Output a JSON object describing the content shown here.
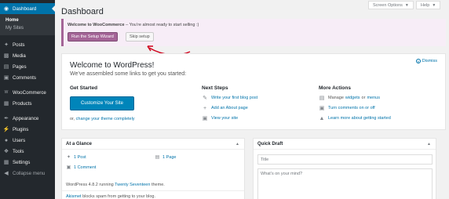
{
  "sidebar": {
    "dashboard": "Dashboard",
    "sub": {
      "home": "Home",
      "my_sites": "My Sites"
    },
    "items": [
      {
        "label": "Posts",
        "icon": "pin-icon"
      },
      {
        "label": "Media",
        "icon": "media-icon"
      },
      {
        "label": "Pages",
        "icon": "pages-icon"
      },
      {
        "label": "Comments",
        "icon": "comments-icon"
      }
    ],
    "items2": [
      {
        "label": "WooCommerce",
        "icon": "woocommerce-icon"
      },
      {
        "label": "Products",
        "icon": "products-icon"
      }
    ],
    "items3": [
      {
        "label": "Appearance",
        "icon": "appearance-icon"
      },
      {
        "label": "Plugins",
        "icon": "plugins-icon"
      },
      {
        "label": "Users",
        "icon": "users-icon"
      },
      {
        "label": "Tools",
        "icon": "tools-icon"
      },
      {
        "label": "Settings",
        "icon": "settings-icon"
      },
      {
        "label": "Collapse menu",
        "icon": "collapse-icon"
      }
    ]
  },
  "header": {
    "title": "Dashboard",
    "screen_options": "Screen Options",
    "help": "Help"
  },
  "wc_notice": {
    "bold": "Welcome to WooCommerce",
    "text": " – You’re almost ready to start selling :)",
    "setup_label": "Run the Setup Wizard",
    "skip_label": "Skip setup",
    "accent": "#a46497"
  },
  "welcome": {
    "title": "Welcome to WordPress!",
    "subtitle": "We’ve assembled some links to get you started:",
    "dismiss": "Dismiss",
    "get_started": {
      "heading": "Get Started",
      "button": "Customize Your Site",
      "or_prefix": "or, ",
      "or_link": "change your theme completely"
    },
    "next_steps": {
      "heading": "Next Steps",
      "items": [
        {
          "label": "Write your first blog post",
          "icon": "edit-icon"
        },
        {
          "label": "Add an About page",
          "icon": "plus-icon"
        },
        {
          "label": "View your site",
          "icon": "view-site-icon"
        }
      ]
    },
    "more_actions": {
      "heading": "More Actions",
      "manage_prefix": "Manage ",
      "widgets": "widgets",
      "or_word": " or ",
      "menus": "menus",
      "comments": "Turn comments on or off",
      "learn": "Learn more about getting started"
    }
  },
  "at_a_glance": {
    "title": "At a Glance",
    "post": "1 Post",
    "page": "1 Page",
    "comment": "1 Comment",
    "version_prefix": "WordPress 4.8.2 running ",
    "theme": "Twenty Seventeen",
    "version_suffix": " theme.",
    "akismet_link": "Akismet",
    "akismet_text": " blocks spam from getting to your blog."
  },
  "quick_draft": {
    "title": "Quick Draft",
    "title_placeholder": "Title",
    "content_placeholder": "What’s on your mind?"
  },
  "colors": {
    "sidebar": "#23282d",
    "active": "#0073aa",
    "button_primary": "#0085ba",
    "annotation_arrow": "#d0021b"
  }
}
